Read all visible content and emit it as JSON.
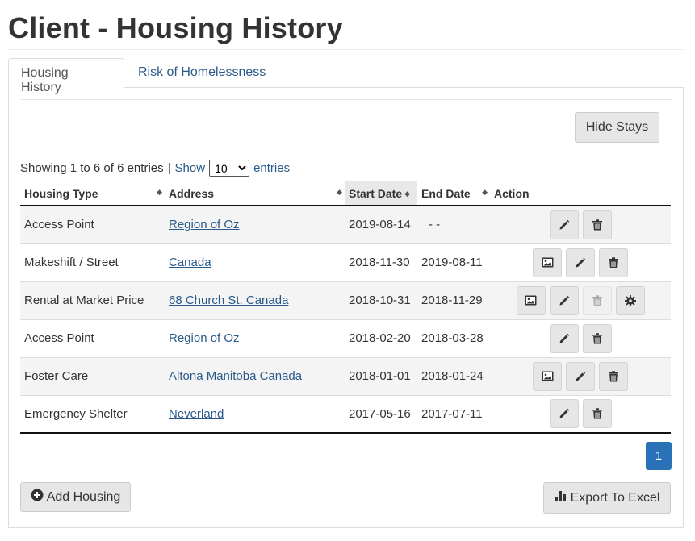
{
  "page": {
    "title": "Client - Housing History"
  },
  "tabs": [
    {
      "label": "Housing History",
      "active": true
    },
    {
      "label": "Risk of Homelessness",
      "active": false
    }
  ],
  "toolbar": {
    "hide_stays_label": "Hide Stays"
  },
  "table_info": {
    "showing": "Showing 1 to 6 of 6 entries",
    "separator": "|",
    "show_label": "Show",
    "page_size": "10",
    "entries_label": "entries"
  },
  "columns": [
    "Housing Type",
    "Address",
    "Start Date",
    "End Date",
    "Action"
  ],
  "rows": [
    {
      "type": "Access Point",
      "address": "Region of Oz",
      "start": "2019-08-14",
      "end": "- -",
      "actions": [
        "edit",
        "delete"
      ]
    },
    {
      "type": "Makeshift / Street",
      "address": "Canada ",
      "start": "2018-11-30",
      "end": "2019-08-11",
      "actions": [
        "image",
        "edit",
        "delete"
      ]
    },
    {
      "type": "Rental at Market Price",
      "address": "68 Church St. Canada ",
      "start": "2018-10-31",
      "end": "2018-11-29",
      "actions": [
        "image",
        "edit",
        "delete-disabled",
        "settings"
      ]
    },
    {
      "type": "Access Point",
      "address": "Region of Oz",
      "start": "2018-02-20",
      "end": "2018-03-28",
      "actions": [
        "edit",
        "delete"
      ]
    },
    {
      "type": "Foster Care",
      "address": "Altona Manitoba Canada ",
      "start": "2018-01-01",
      "end": "2018-01-24",
      "actions": [
        "image",
        "edit",
        "delete"
      ]
    },
    {
      "type": "Emergency Shelter",
      "address": "Neverland",
      "start": "2017-05-16",
      "end": "2017-07-11",
      "actions": [
        "edit",
        "delete"
      ]
    }
  ],
  "pagination": {
    "current_page": "1"
  },
  "footer": {
    "add_label": "Add Housing",
    "export_label": "Export To Excel"
  },
  "colors": {
    "link": "#2a5a8a",
    "primary": "#2a72b8",
    "button_bg": "#e6e6e6"
  }
}
